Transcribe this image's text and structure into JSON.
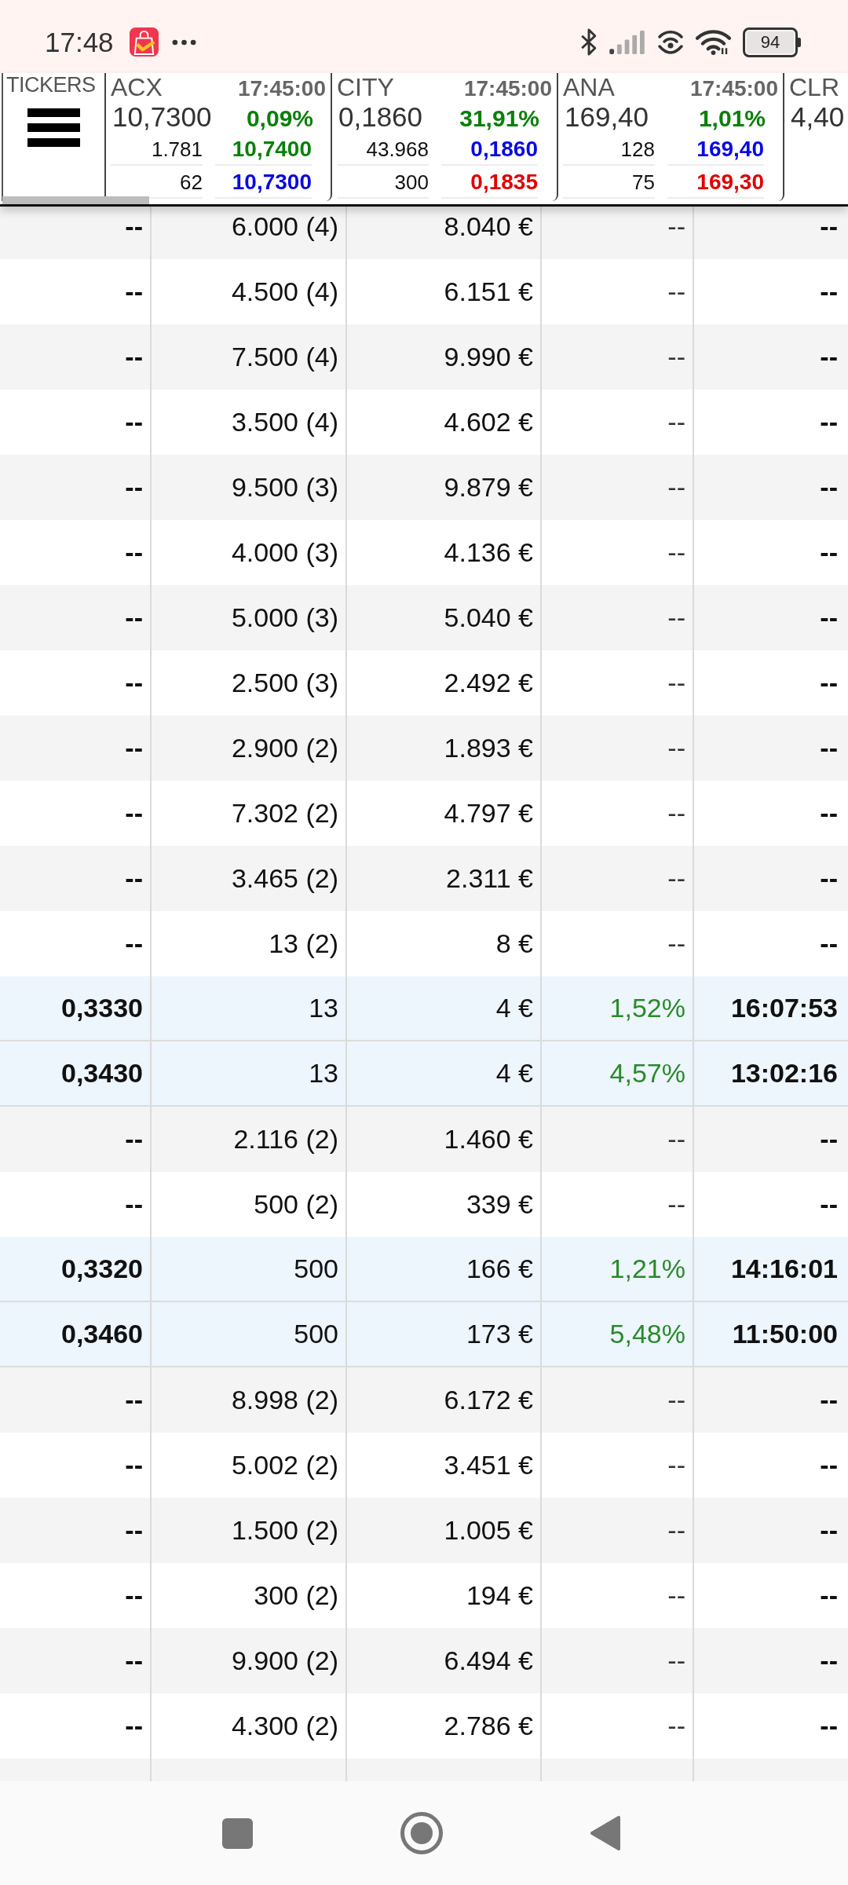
{
  "status_bar": {
    "time": "17:48",
    "battery": "94"
  },
  "ticker_bar": {
    "label": "TICKERS",
    "tickers": [
      {
        "symbol": "ACX",
        "time": "17:45:00",
        "price": "10,7300",
        "change": {
          "text": "0,09%",
          "color": "#0b800b"
        },
        "levels": [
          {
            "volume": "1.781",
            "price": "10,7400",
            "color": "#0b800b"
          },
          {
            "volume": "62",
            "price": "10,7300",
            "color": "#0a0ae0"
          }
        ]
      },
      {
        "symbol": "CITY",
        "time": "17:45:00",
        "price": "0,1860",
        "change": {
          "text": "31,91%",
          "color": "#0b800b"
        },
        "levels": [
          {
            "volume": "43.968",
            "price": "0,1860",
            "color": "#0a0ae0"
          },
          {
            "volume": "300",
            "price": "0,1835",
            "color": "#e00000"
          }
        ]
      },
      {
        "symbol": "ANA",
        "time": "17:45:00",
        "price": "169,40",
        "change": {
          "text": "1,01%",
          "color": "#0b800b"
        },
        "levels": [
          {
            "volume": "128",
            "price": "169,40",
            "color": "#0a0ae0"
          },
          {
            "volume": "75",
            "price": "169,30",
            "color": "#e00000"
          }
        ]
      },
      {
        "symbol": "CLR",
        "price": "4,40"
      }
    ]
  },
  "table": {
    "rows": [
      {
        "kind": "group",
        "cells": [
          "--",
          "6.000 (4)",
          "8.040 €",
          "--",
          "--"
        ]
      },
      {
        "kind": "group",
        "cells": [
          "--",
          "4.500 (4)",
          "6.151 €",
          "--",
          "--"
        ]
      },
      {
        "kind": "group",
        "cells": [
          "--",
          "7.500 (4)",
          "9.990 €",
          "--",
          "--"
        ]
      },
      {
        "kind": "group",
        "cells": [
          "--",
          "3.500 (4)",
          "4.602 €",
          "--",
          "--"
        ]
      },
      {
        "kind": "group",
        "cells": [
          "--",
          "9.500 (3)",
          "9.879 €",
          "--",
          "--"
        ]
      },
      {
        "kind": "group",
        "cells": [
          "--",
          "4.000 (3)",
          "4.136 €",
          "--",
          "--"
        ]
      },
      {
        "kind": "group",
        "cells": [
          "--",
          "5.000 (3)",
          "5.040 €",
          "--",
          "--"
        ]
      },
      {
        "kind": "group",
        "cells": [
          "--",
          "2.500 (3)",
          "2.492 €",
          "--",
          "--"
        ]
      },
      {
        "kind": "group",
        "cells": [
          "--",
          "2.900 (2)",
          "1.893 €",
          "--",
          "--"
        ]
      },
      {
        "kind": "group",
        "cells": [
          "--",
          "7.302 (2)",
          "4.797 €",
          "--",
          "--"
        ]
      },
      {
        "kind": "group",
        "cells": [
          "--",
          "3.465 (2)",
          "2.311 €",
          "--",
          "--"
        ]
      },
      {
        "kind": "group",
        "cells": [
          "--",
          "13 (2)",
          "8 €",
          "--",
          "--"
        ]
      },
      {
        "kind": "trade",
        "cells": [
          "0,3330",
          "13",
          "4 €",
          "1,52%",
          "16:07:53"
        ]
      },
      {
        "kind": "trade",
        "cells": [
          "0,3430",
          "13",
          "4 €",
          "4,57%",
          "13:02:16"
        ]
      },
      {
        "kind": "group",
        "cells": [
          "--",
          "2.116 (2)",
          "1.460 €",
          "--",
          "--"
        ]
      },
      {
        "kind": "group",
        "cells": [
          "--",
          "500 (2)",
          "339 €",
          "--",
          "--"
        ]
      },
      {
        "kind": "trade",
        "cells": [
          "0,3320",
          "500",
          "166 €",
          "1,21%",
          "14:16:01"
        ]
      },
      {
        "kind": "trade",
        "cells": [
          "0,3460",
          "500",
          "173 €",
          "5,48%",
          "11:50:00"
        ]
      },
      {
        "kind": "group",
        "cells": [
          "--",
          "8.998 (2)",
          "6.172 €",
          "--",
          "--"
        ]
      },
      {
        "kind": "group",
        "cells": [
          "--",
          "5.002 (2)",
          "3.451 €",
          "--",
          "--"
        ]
      },
      {
        "kind": "group",
        "cells": [
          "--",
          "1.500 (2)",
          "1.005 €",
          "--",
          "--"
        ]
      },
      {
        "kind": "group",
        "cells": [
          "--",
          "300 (2)",
          "194 €",
          "--",
          "--"
        ]
      },
      {
        "kind": "group",
        "cells": [
          "--",
          "9.900 (2)",
          "6.494 €",
          "--",
          "--"
        ]
      },
      {
        "kind": "group",
        "cells": [
          "--",
          "4.300 (2)",
          "2.786 €",
          "--",
          "--"
        ]
      }
    ]
  }
}
